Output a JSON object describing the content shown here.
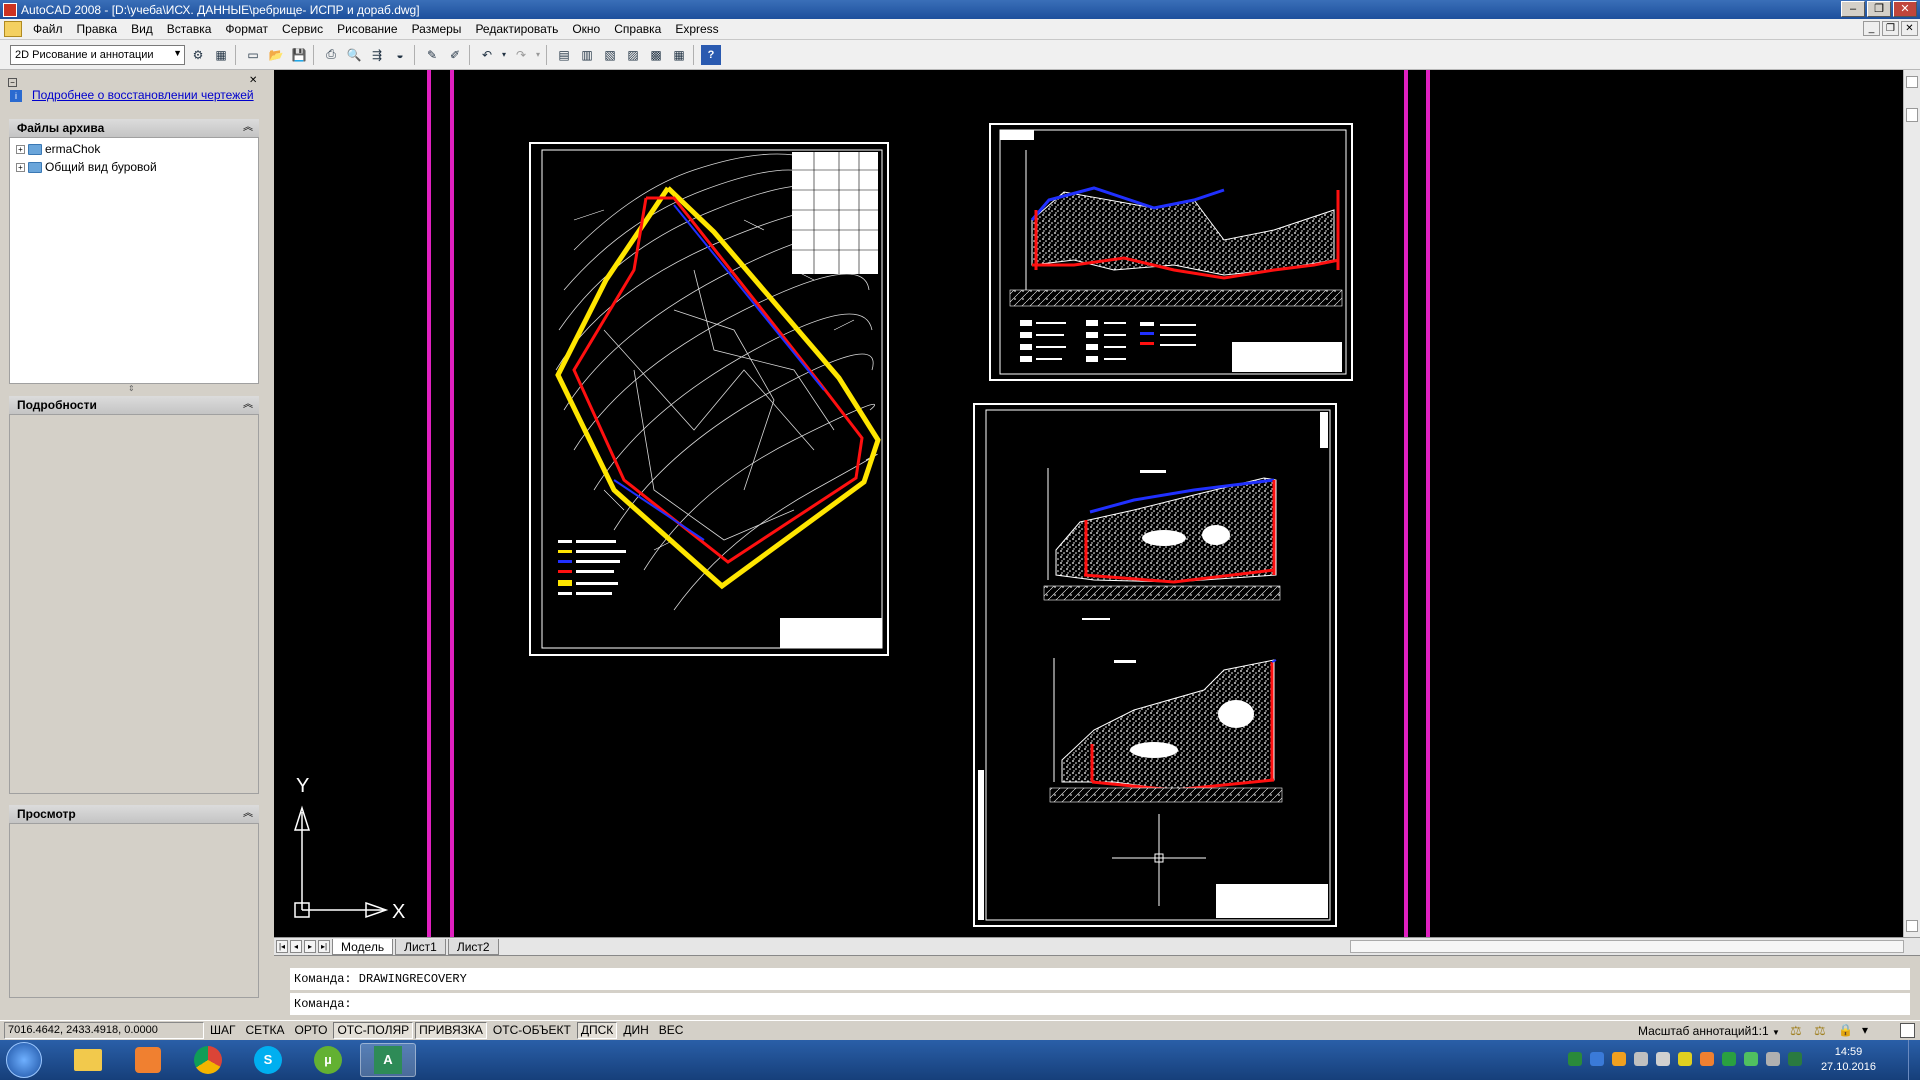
{
  "window": {
    "title": "AutoCAD 2008 - [D:\\учеба\\ИСХ. ДАННЫЕ\\ребрище- ИСПР и дораб.dwg]"
  },
  "menu": [
    "Файл",
    "Правка",
    "Вид",
    "Вставка",
    "Формат",
    "Сервис",
    "Рисование",
    "Размеры",
    "Редактировать",
    "Окно",
    "Справка",
    "Express"
  ],
  "toolbar": {
    "workspace": "2D Рисование и аннотации"
  },
  "left_panel": {
    "recovery_link": "Подробнее о восстановлении чертежей",
    "archive_title": "Файлы архива",
    "archive_items": [
      "ermaChok",
      "Общий вид  буровой"
    ],
    "details_title": "Подробности",
    "preview_title": "Просмотр"
  },
  "ucs": {
    "y_label": "Y",
    "x_label": "X"
  },
  "layout_tabs": [
    "Модель",
    "Лист1",
    "Лист2"
  ],
  "command": {
    "history": "Команда: DRAWINGRECOVERY",
    "prompt": "Команда:"
  },
  "status": {
    "coords": "7016.4642, 2433.4918, 0.0000",
    "toggles": [
      {
        "label": "ШАГ",
        "on": false
      },
      {
        "label": "СЕТКА",
        "on": false
      },
      {
        "label": "ОРТО",
        "on": false
      },
      {
        "label": "ОТС-ПОЛЯР",
        "on": true
      },
      {
        "label": "ПРИВЯЗКА",
        "on": true
      },
      {
        "label": "ОТС-ОБЪЕКТ",
        "on": false
      },
      {
        "label": "ДПСК",
        "on": true
      },
      {
        "label": "ДИН",
        "on": false
      },
      {
        "label": "ВЕС",
        "on": false
      }
    ],
    "annotation_scale_label": "Масштаб аннотаций:",
    "annotation_scale_value": "1:1"
  },
  "taskbar": {
    "time": "14:59",
    "date": "27.10.2016"
  },
  "colors": {
    "magenta": "#e020c0",
    "red": "#ff1010",
    "yellow": "#ffe600",
    "blue": "#2030ff"
  }
}
